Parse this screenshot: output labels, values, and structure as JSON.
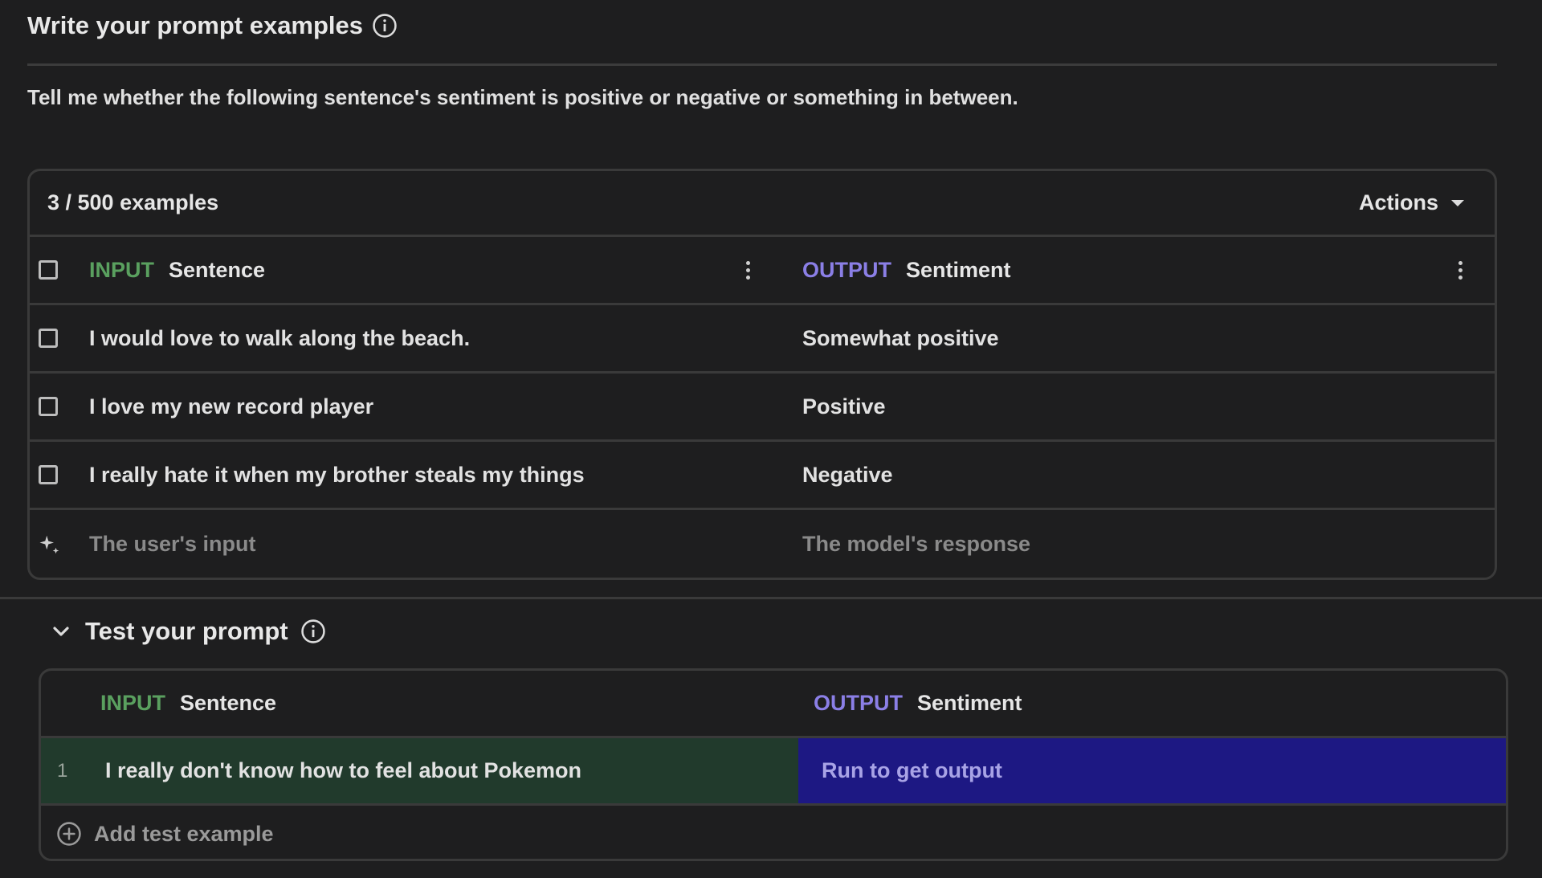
{
  "examples_section": {
    "title": "Write your prompt examples",
    "prompt": "Tell me whether the following sentence's sentiment is positive or negative or something in between.",
    "count": "3 / 500 examples",
    "actions_label": "Actions",
    "columns": {
      "input_tag": "INPUT",
      "input_name": "Sentence",
      "output_tag": "OUTPUT",
      "output_name": "Sentiment"
    },
    "rows": [
      {
        "input": "I would love to walk along the beach.",
        "output": "Somewhat positive"
      },
      {
        "input": "I love my new record player",
        "output": "Positive"
      },
      {
        "input": "I really hate it when my brother steals my things",
        "output": "Negative"
      }
    ],
    "new_row": {
      "input_placeholder": "The user's input",
      "output_placeholder": "The model's response"
    }
  },
  "test_section": {
    "title": "Test your prompt",
    "columns": {
      "input_tag": "INPUT",
      "input_name": "Sentence",
      "output_tag": "OUTPUT",
      "output_name": "Sentiment"
    },
    "rows": [
      {
        "number": "1",
        "input": "I really don't know how to feel about Pokemon",
        "output": "Run to get output"
      }
    ],
    "add_label": "Add test example"
  },
  "colors": {
    "input_tag": "#5aa05f",
    "output_tag": "#8b7fe6",
    "test_input_bg": "#213a2c",
    "test_output_bg": "#1d1883"
  },
  "icons": [
    "info-icon",
    "chevron-down-icon",
    "kebab-menu-icon",
    "sparkle-add-icon",
    "plus-circle-icon",
    "caret-down-icon"
  ]
}
